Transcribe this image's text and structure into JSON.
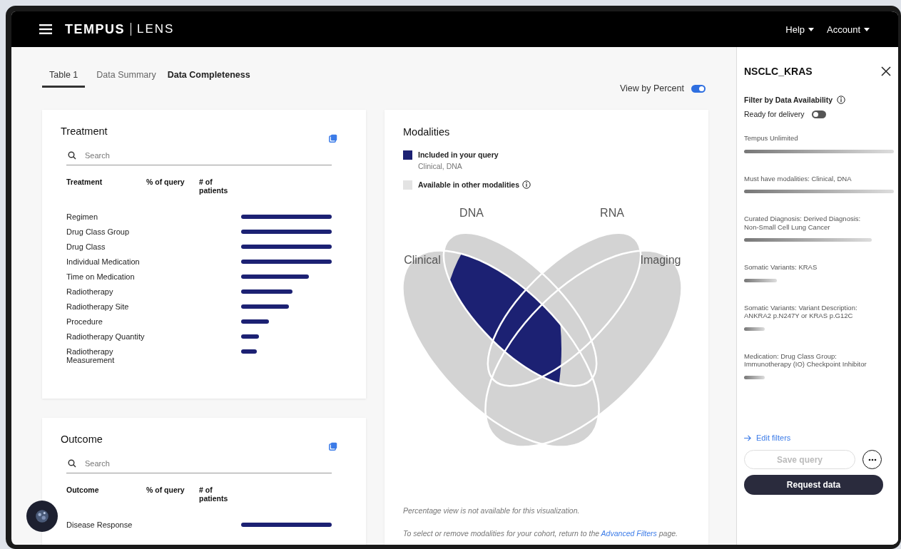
{
  "header": {
    "brand_bold": "TEMPUS",
    "brand_light": "LENS",
    "menus": [
      {
        "label": "Help"
      },
      {
        "label": "Account"
      }
    ]
  },
  "tabs": [
    {
      "label": "Table 1",
      "selected": true,
      "emphasized": false
    },
    {
      "label": "Data Summary",
      "selected": false,
      "emphasized": false
    },
    {
      "label": "Data Completeness",
      "selected": false,
      "emphasized": true
    }
  ],
  "view_toggle": {
    "label": "View by Percent",
    "on": true
  },
  "cards": [
    {
      "title": "Treatment",
      "search": {
        "placeholder": "Search"
      },
      "columns": [
        "Treatment",
        "% of query",
        "# of patients"
      ],
      "rows": [
        {
          "label": "Regimen"
        },
        {
          "label": "Drug Class Group"
        },
        {
          "label": "Drug Class"
        },
        {
          "label": "Individual Medication"
        },
        {
          "label": "Time on Medication"
        },
        {
          "label": "Radiotherapy"
        },
        {
          "label": "Radiotherapy Site"
        },
        {
          "label": "Procedure"
        },
        {
          "label": "Radiotherapy Quantity"
        },
        {
          "label": "Radiotherapy Measurement"
        }
      ]
    },
    {
      "title": "Outcome",
      "search": {
        "placeholder": "Search"
      },
      "columns": [
        "Outcome",
        "% of query",
        "# of patients"
      ],
      "rows": [
        {
          "label": "Disease Response"
        }
      ]
    }
  ],
  "modalities": {
    "title": "Modalities",
    "legend": [
      {
        "label": "Included in your query",
        "sublabel": "Clinical, DNA",
        "color": "#1c2173",
        "info": false
      },
      {
        "label": "Available in other modalities",
        "color": "#e3e3e3",
        "info": true
      }
    ],
    "venn_labels": [
      "DNA",
      "RNA",
      "Clinical",
      "Imaging"
    ],
    "note": "Percentage view is not available for this visualization.",
    "footer": {
      "before": "To select or remove modalities for your cohort, return to the",
      "link": "Advanced Filters",
      "after": "page."
    }
  },
  "panel": {
    "title": "NSCLC_KRAS",
    "filter_heading": "Filter by Data Availability",
    "ready_toggle": {
      "label": "Ready for delivery",
      "on": false
    },
    "filters": [
      {
        "label": "Tempus Unlimited"
      },
      {
        "label": "Must have modalities: Clinical, DNA"
      },
      {
        "label": "Curated Diagnosis: Derived Diagnosis: Non-Small Cell Lung Cancer"
      },
      {
        "label": "Somatic Variants: KRAS"
      },
      {
        "label": "Somatic Variants: Variant Description: ANKRA2 p.N247Y or KRAS p.G12C"
      },
      {
        "label": "Medication: Drug Class Group: Immunotherapy (IO) Checkpoint Inhibitor"
      }
    ],
    "edit_link": "Edit filters",
    "save_button": {
      "label": "Save query",
      "disabled": true
    },
    "request_button": "Request data"
  }
}
